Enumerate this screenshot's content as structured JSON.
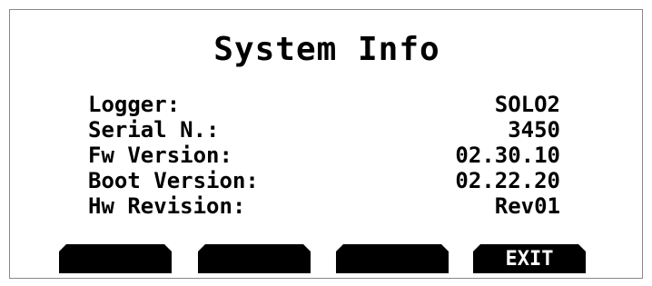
{
  "title": "System Info",
  "info_rows": [
    {
      "label": "Logger:",
      "value": "SOLO2"
    },
    {
      "label": "Serial N.:",
      "value": "3450"
    },
    {
      "label": "Fw Version:",
      "value": "02.30.10"
    },
    {
      "label": "Boot Version:",
      "value": "02.22.20"
    },
    {
      "label": "Hw Revision:",
      "value": "Rev01"
    }
  ],
  "softkeys": [
    "",
    "",
    "",
    "EXIT"
  ],
  "colors": {
    "background": "#ffffff",
    "foreground": "#000000",
    "border": "#888888"
  }
}
